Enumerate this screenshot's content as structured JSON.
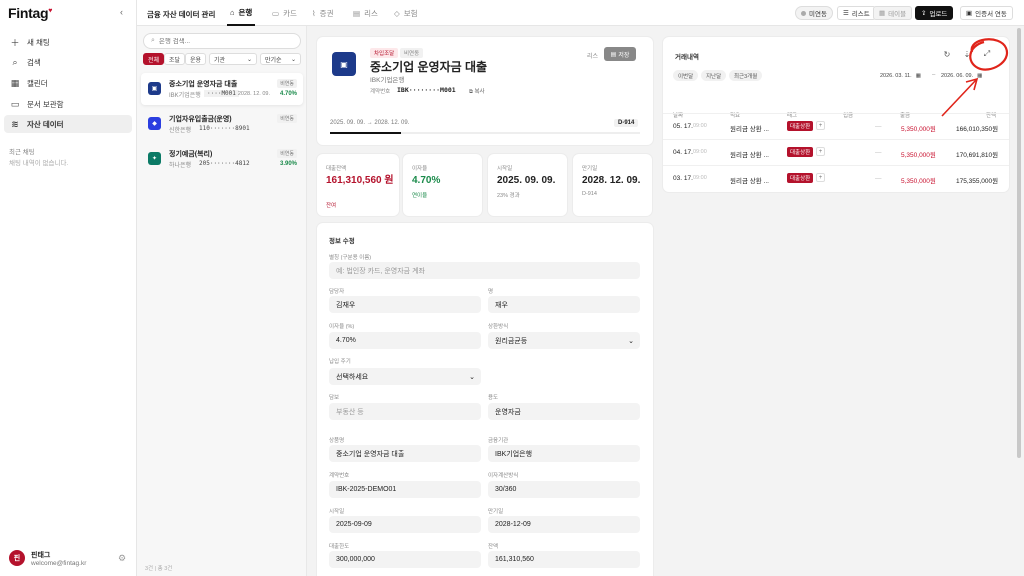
{
  "brand": {
    "logo": "Fintag",
    "logo_mark": "♥"
  },
  "sidebar": {
    "items": [
      {
        "label": "새 채팅",
        "icon": "plus-icon"
      },
      {
        "label": "검색",
        "icon": "search-icon"
      },
      {
        "label": "캘린더",
        "icon": "calendar-icon"
      },
      {
        "label": "문서 보관함",
        "icon": "folder-icon"
      },
      {
        "label": "자산 데이터",
        "icon": "database-icon"
      }
    ],
    "recent_title": "최근 채팅",
    "recent_empty": "채팅 내역이 없습니다.",
    "user": {
      "avatar": "핀",
      "name": "핀태그",
      "email": "welcome@fintag.kr"
    }
  },
  "topbar": {
    "title": "금융 자산 데이터 관리",
    "tabs": [
      "은행",
      "카드",
      "증권",
      "리스",
      "보험"
    ],
    "unlinked": "미연동",
    "view_list": "리스트",
    "view_table": "테이블",
    "upload": "업로드",
    "cert_link": "인증서 연동"
  },
  "list": {
    "search_placeholder": "은행 검색...",
    "filters": [
      "전체",
      "조달",
      "운용"
    ],
    "select_period": "기관",
    "select_sort": "만기순",
    "accounts": [
      {
        "name": "중소기업 운영자금 대출",
        "bank": "IBK기업은행",
        "number": "····M001",
        "badge": "비연동",
        "date": "2028. 12. 09.",
        "rate": "4.70%",
        "color": "#1d3a8a",
        "glyph": "▣"
      },
      {
        "name": "기업자유입출금(운영)",
        "bank": "신한은행",
        "number": "110·······8901",
        "badge": "비연동",
        "date": "",
        "rate": "",
        "color": "#2b3ee0",
        "glyph": "◆"
      },
      {
        "name": "정기예금(복리)",
        "bank": "하나은행",
        "number": "205·······4812",
        "badge": "비연동",
        "date": "",
        "rate": "3.90%",
        "color": "#0b7a66",
        "glyph": "✦"
      }
    ],
    "count": "3건 | 총 3건"
  },
  "detail": {
    "tag_type": "차입조달",
    "tag_status": "비연동",
    "title": "중소기업 운영자금 대출",
    "bank": "IBK기업은행",
    "acct_label": "계약번호",
    "acct_no": "IBK········M001",
    "copy": "복사",
    "memo": "리스",
    "save": "저장",
    "period": "2025. 09. 09. → 2028. 12. 09.",
    "dday": "D-914",
    "progress": 0.23
  },
  "stats": [
    {
      "label": "대출잔액",
      "value": "161,310,560 원",
      "sub": "잔여",
      "color": "#b4122c"
    },
    {
      "label": "이자율",
      "value": "4.70%",
      "sub": "연이율",
      "color": "#1a8a4a"
    },
    {
      "label": "시작일",
      "value": "2025. 09. 09.",
      "sub": "23% 경과",
      "color": "#111"
    },
    {
      "label": "만기일",
      "value": "2028. 12. 09.",
      "sub": "D-914",
      "color": "#111"
    }
  ],
  "form": {
    "title": "정보 수정",
    "fields": {
      "alias_label": "별칭 (구분용 이름)",
      "alias_ph": "예: 법인장 카드, 운영자금 계좌",
      "manager_label": "담당자",
      "manager": "김재우",
      "owner_label": "명",
      "owner": "재우",
      "rate_label": "이자율 (%)",
      "rate": "4.70%",
      "repay_label": "상환방식",
      "repay": "원리금균등",
      "cycle_label": "납입 주기",
      "cycle": "선택하세요",
      "collateral_label": "담보",
      "collateral_ph": "부동산 등",
      "purpose_label": "용도",
      "purpose": "운영자금",
      "product_label": "상품명",
      "product": "중소기업 운영자금 대출",
      "inst_label": "금융기관",
      "inst": "IBK기업은행",
      "contract_label": "계약번호",
      "contract": "IBK-2025-DEMO01",
      "daycount_label": "이자계산방식",
      "daycount": "30/360",
      "start_label": "시작일",
      "start": "2025-09-09",
      "end_label": "만기일",
      "end": "2028-12-09",
      "limit_label": "대출한도",
      "limit": "300,000,000",
      "balance_label": "잔액",
      "balance": "161,310,560"
    }
  },
  "transactions": {
    "title": "거래내역",
    "periods": [
      "이번달",
      "지난달",
      "최근3개월"
    ],
    "date_from": "2026. 03. 11.",
    "date_to": "2026. 06. 09.",
    "headers": [
      "날짜",
      "적요",
      "태그",
      "입금",
      "출금",
      "잔액"
    ],
    "rows": [
      {
        "date": "05. 17.",
        "time": "09:00",
        "desc": "원리금 상환 ...",
        "tag": "대출상환",
        "in": "—",
        "out": "5,350,000원",
        "balance": "166,010,350원"
      },
      {
        "date": "04. 17.",
        "time": "09:00",
        "desc": "원리금 상환 ...",
        "tag": "대출상환",
        "in": "—",
        "out": "5,350,000원",
        "balance": "170,691,810원"
      },
      {
        "date": "03. 17.",
        "time": "09:00",
        "desc": "원리금 상환 ...",
        "tag": "대출상환",
        "in": "—",
        "out": "5,350,000원",
        "balance": "175,355,000원"
      }
    ]
  }
}
